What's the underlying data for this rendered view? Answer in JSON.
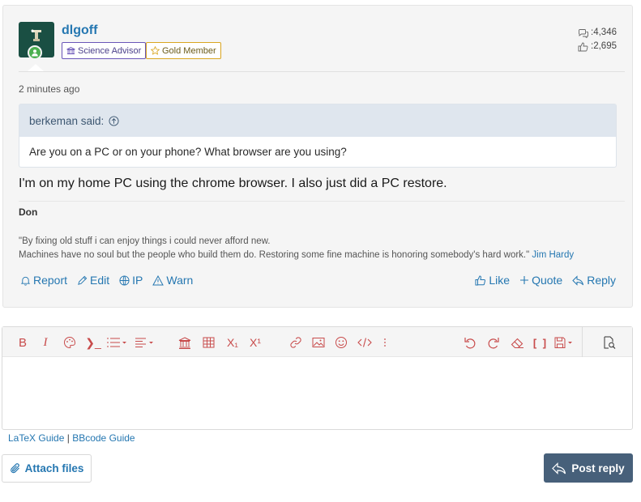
{
  "post": {
    "username": "dlgoff",
    "badges": {
      "science_advisor": "Science Advisor",
      "gold_member": "Gold Member"
    },
    "stats": {
      "messages": ":4,346",
      "reactions": ":2,695"
    },
    "time": "2 minutes ago",
    "quote": {
      "author_line": "berkeman said:",
      "text": "Are you on a PC or on your phone? What browser are you using?"
    },
    "message": "I'm on my home PC using the chrome browser. I also just did a PC restore.",
    "signature": {
      "name": "Don",
      "line1": "\"By fixing old stuff i can enjoy things i could never afford new.",
      "line2": "Machines have no soul but the people who build them do. Restoring some fine machine is honoring somebody's hard work.\"",
      "author": "Jim Hardy"
    },
    "actions": {
      "report": "Report",
      "edit": "Edit",
      "ip": "IP",
      "warn": "Warn",
      "like": "Like",
      "quote": "Quote",
      "reply": "Reply"
    }
  },
  "editor": {
    "toolbar_icons": [
      "bold-icon",
      "italic-icon",
      "palette-icon",
      "code-inline-icon",
      "list-icon",
      "align-icon",
      "institution-icon",
      "table-icon",
      "subscript-icon",
      "superscript-icon",
      "link-icon",
      "image-icon",
      "emoji-icon",
      "code-icon",
      "more-icon",
      "undo-icon",
      "redo-icon",
      "eraser-icon",
      "bbcode-icon",
      "save-draft-icon",
      "preview-icon"
    ],
    "bold": "B",
    "italic": "I",
    "subscript": "X₁",
    "superscript": "X¹",
    "code_inline": "❯_",
    "bbcode": "[ ]"
  },
  "footer": {
    "latex_guide": "LaTeX Guide",
    "separator": "|",
    "bbcode_guide": "BBcode Guide",
    "attach": "Attach files",
    "post_reply": "Post reply"
  },
  "colors": {
    "link": "#2577b1",
    "toolbar_icon": "#c84b4b",
    "primary_button": "#47607a",
    "quote_header": "#dfe6ee"
  }
}
